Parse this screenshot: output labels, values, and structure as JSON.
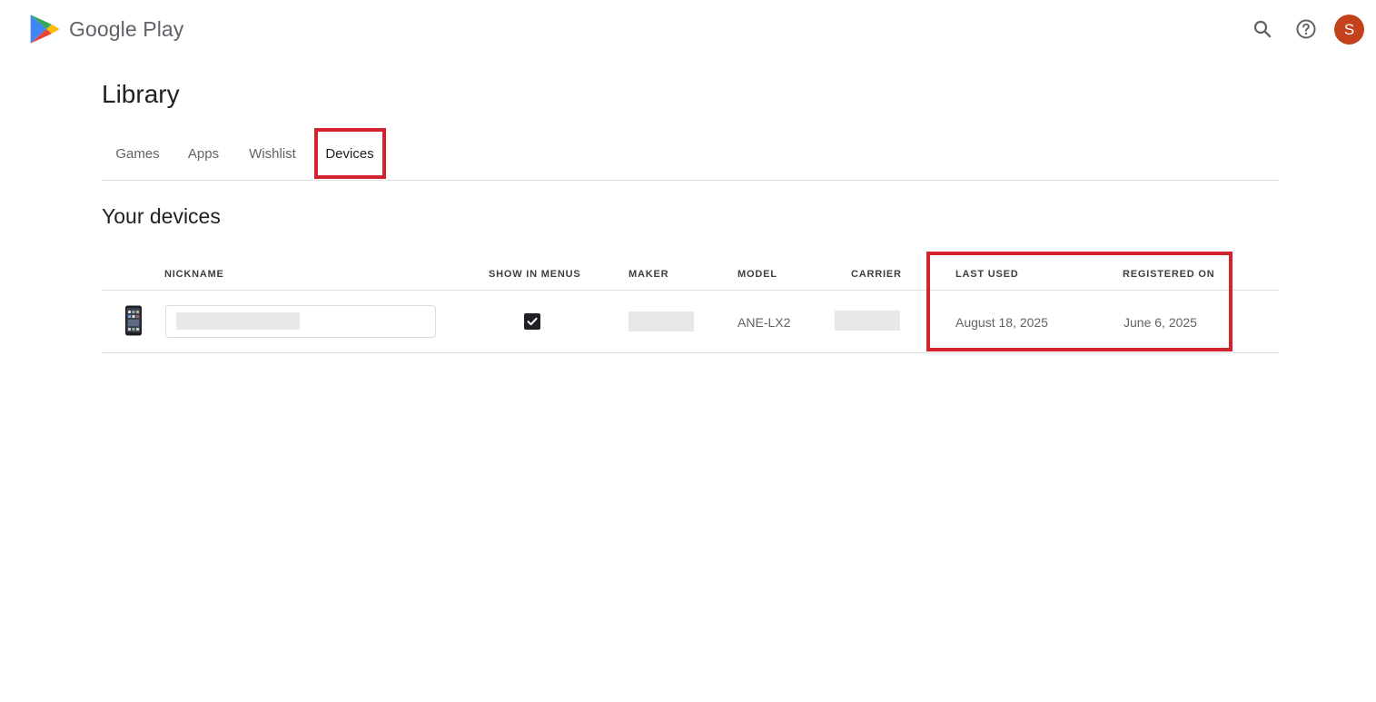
{
  "header": {
    "brand_name": "Google Play",
    "search_icon": "search-icon",
    "help_icon": "help-circle-icon",
    "avatar_letter": "S",
    "avatar_color": "#c3411b"
  },
  "library": {
    "title": "Library",
    "tabs": [
      {
        "label": "Games",
        "active": false
      },
      {
        "label": "Apps",
        "active": false
      },
      {
        "label": "Wishlist",
        "active": false
      },
      {
        "label": "Devices",
        "active": true
      }
    ],
    "accent_color": "#01875f"
  },
  "devices": {
    "title": "Your devices",
    "columns": {
      "nickname": "NICKNAME",
      "show_in_menus": "SHOW IN MENUS",
      "maker": "MAKER",
      "model": "MODEL",
      "carrier": "CARRIER",
      "last_used": "LAST USED",
      "registered_on": "REGISTERED ON"
    },
    "rows": [
      {
        "icon": "smartphone-icon",
        "nickname": "",
        "show_in_menus": true,
        "maker": "",
        "model": "ANE-LX2",
        "carrier": "",
        "last_used": "August 18, 2025",
        "registered_on": "June 6, 2025"
      }
    ]
  },
  "annotations": {
    "highlight_color": "#d3232f"
  }
}
